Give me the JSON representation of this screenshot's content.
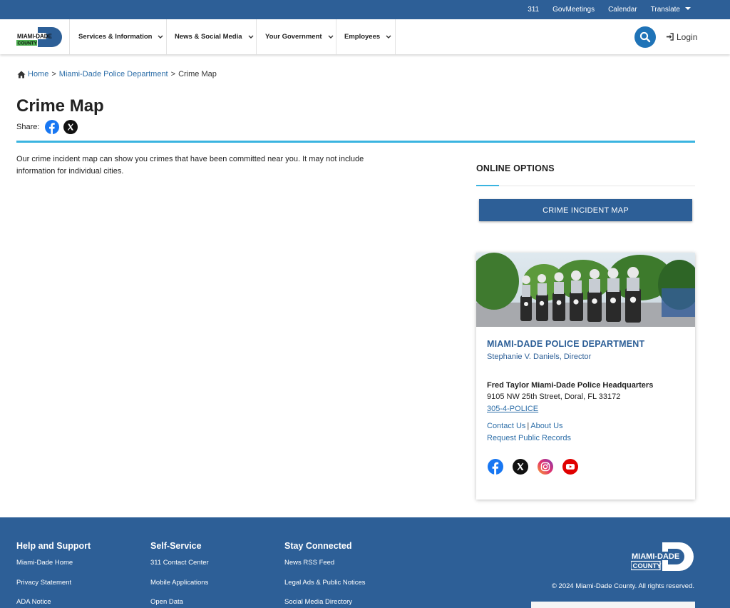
{
  "topbar": {
    "links": [
      "311",
      "GovMeetings",
      "Calendar",
      "Translate"
    ]
  },
  "logo": {
    "line1": "MIAMI-DADE",
    "line2": "COUNTY"
  },
  "nav": {
    "items": [
      "Services & Information",
      "News & Social Media",
      "Your Government",
      "Employees"
    ],
    "login": "Login"
  },
  "breadcrumb": {
    "home": "Home",
    "parent": "Miami-Dade Police Department",
    "current": "Crime Map",
    "separator": ">"
  },
  "page": {
    "title": "Crime Map",
    "share_label": "Share:",
    "intro": "Our crime incident map can show you crimes that have been committed near you. It may not include information for individual cities."
  },
  "online_options": {
    "title": "ONLINE OPTIONS",
    "button": "CRIME INCIDENT MAP"
  },
  "dept": {
    "name": "MIAMI-DADE POLICE DEPARTMENT",
    "director": "Stephanie V. Daniels, Director",
    "hq": "Fred Taylor Miami-Dade Police Headquarters",
    "address": "9105 NW 25th Street, Doral, FL 33172",
    "phone": "305-4-POLICE",
    "contact": "Contact Us",
    "about": "About Us",
    "pipe": "|",
    "records": "Request Public Records"
  },
  "footer": {
    "columns": [
      {
        "title": "Help and Support",
        "links": [
          "Miami-Dade Home",
          "Privacy Statement",
          "ADA Notice"
        ]
      },
      {
        "title": "Self-Service",
        "links": [
          "311 Contact Center",
          "Mobile Applications",
          "Open Data"
        ]
      },
      {
        "title": "Stay Connected",
        "links": [
          "News RSS Feed",
          "Legal Ads & Public Notices",
          "Social Media Directory"
        ]
      }
    ],
    "copyright": "© 2024 Miami-Dade County. All rights reserved."
  },
  "colors": {
    "brand_blue": "#2d5f97",
    "accent_cyan": "#3ab4e0",
    "link_blue": "#2d6ea8",
    "search_blue": "#1f73b7"
  },
  "icons": {
    "share": [
      "facebook-icon",
      "x-icon"
    ],
    "social": [
      "facebook-icon",
      "x-icon",
      "instagram-icon",
      "youtube-icon"
    ]
  }
}
